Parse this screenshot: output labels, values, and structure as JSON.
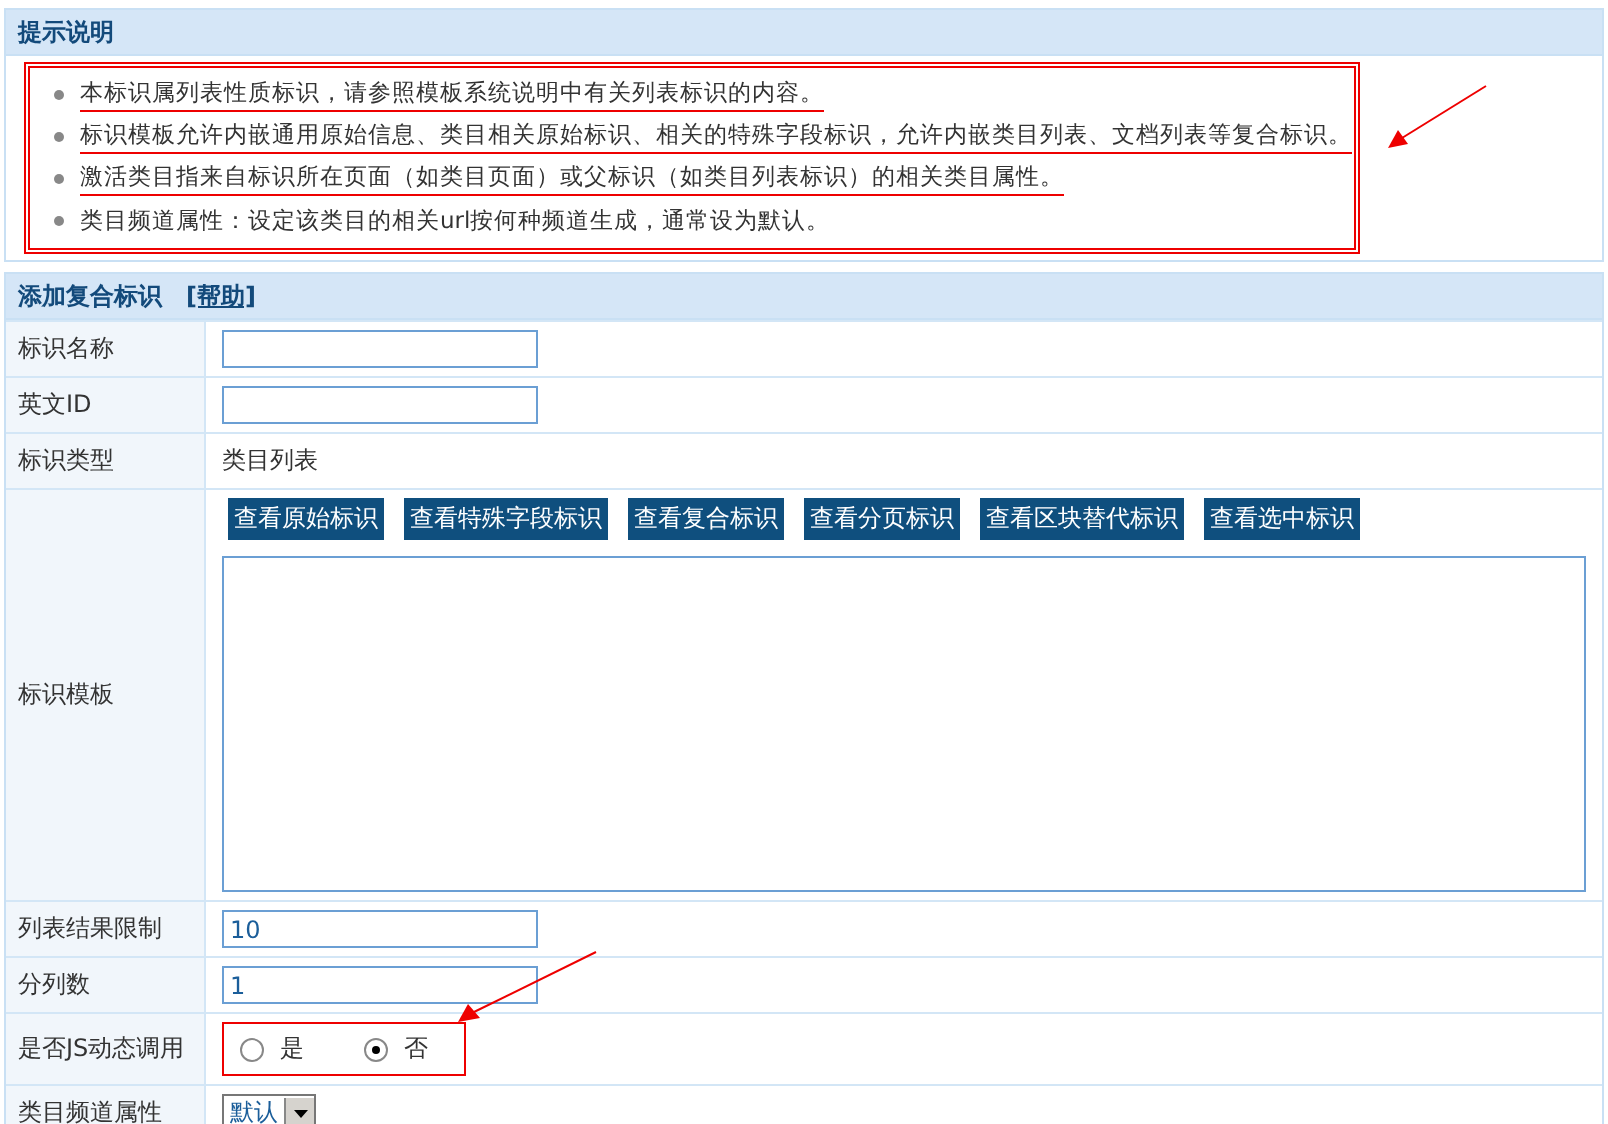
{
  "notes": {
    "title": "提示说明",
    "items": [
      {
        "text": "本标识属列表性质标识，请参照模板系统说明中有关列表标识的内容。",
        "underlined": true
      },
      {
        "text": "标识模板允许内嵌通用原始信息、类目相关原始标识、相关的特殊字段标识，允许内嵌类目列表、文档列表等复合标识。",
        "underlined": true
      },
      {
        "text": "激活类目指来自标识所在页面（如类目页面）或父标识（如类目列表标识）的相关类目属性。",
        "underlined": true
      },
      {
        "text": "类目频道属性：设定该类目的相关url按何种频道生成，通常设为默认。",
        "underlined": false
      }
    ]
  },
  "form": {
    "title": "添加复合标识",
    "help_link": "[帮助]",
    "rows": [
      {
        "kind": "input",
        "label": "标识名称",
        "value": ""
      },
      {
        "kind": "input",
        "label": "英文ID",
        "value": ""
      },
      {
        "kind": "text",
        "label": "标识类型",
        "value": "类目列表"
      },
      {
        "kind": "template",
        "label": "标识模板",
        "buttons": [
          "查看原始标识",
          "查看特殊字段标识",
          "查看复合标识",
          "查看分页标识",
          "查看区块替代标识",
          "查看选中标识"
        ]
      },
      {
        "kind": "input",
        "label": "列表结果限制",
        "value": "10"
      },
      {
        "kind": "input",
        "label": "分列数",
        "value": "1"
      },
      {
        "kind": "radio",
        "label": "是否JS动态调用",
        "options": [
          {
            "label": "是",
            "selected": false
          },
          {
            "label": "否",
            "selected": true
          }
        ]
      },
      {
        "kind": "select",
        "label": "类目频道属性",
        "value": "默认"
      }
    ]
  }
}
